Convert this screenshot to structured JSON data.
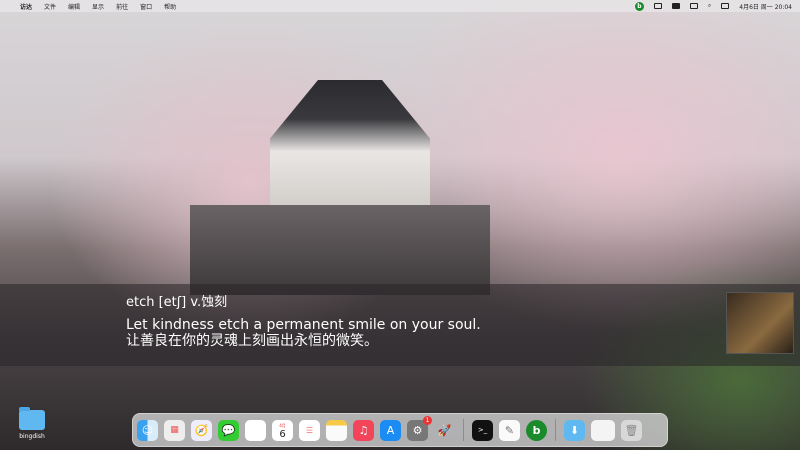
{
  "menubar": {
    "app_name": "访达",
    "items": [
      "文件",
      "编辑",
      "显示",
      "前往",
      "窗口",
      "帮助"
    ],
    "clock": "4月6日 周一 20:04"
  },
  "subtitle": {
    "word_line": "etch [etʃ] v.蚀刻",
    "sentence_en": "Let kindness etch a permanent smile on your soul.",
    "sentence_zh": "让善良在你的灵魂上刻画出永恒的微笑。"
  },
  "desktop": {
    "folder_label": "bingdish"
  },
  "dock": {
    "calendar_month": "4月",
    "calendar_day": "6",
    "settings_badge": "1"
  },
  "colors": {
    "bing_green": "#1a8a2a"
  }
}
